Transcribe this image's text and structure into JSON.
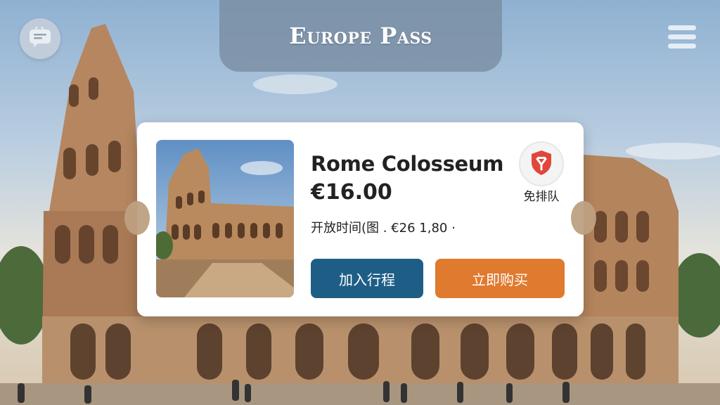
{
  "brand": {
    "title": "Europe Pass"
  },
  "ticket": {
    "title": "Rome Colosseum",
    "price": "€16.00",
    "hours": "开放时间(图 . €26 1,80 ·",
    "badge": "免排队",
    "add_label": "加入行程",
    "buy_label": "立即购买"
  },
  "icons": {
    "chat": "chat-bubble-icon",
    "menu": "hamburger-menu-icon",
    "badge": "shield-skip-queue-icon"
  },
  "colors": {
    "add_button": "#1e5e86",
    "buy_button": "#df7a2e",
    "badge_shield": "#e0473a",
    "brand_bar": "#788ca0"
  }
}
